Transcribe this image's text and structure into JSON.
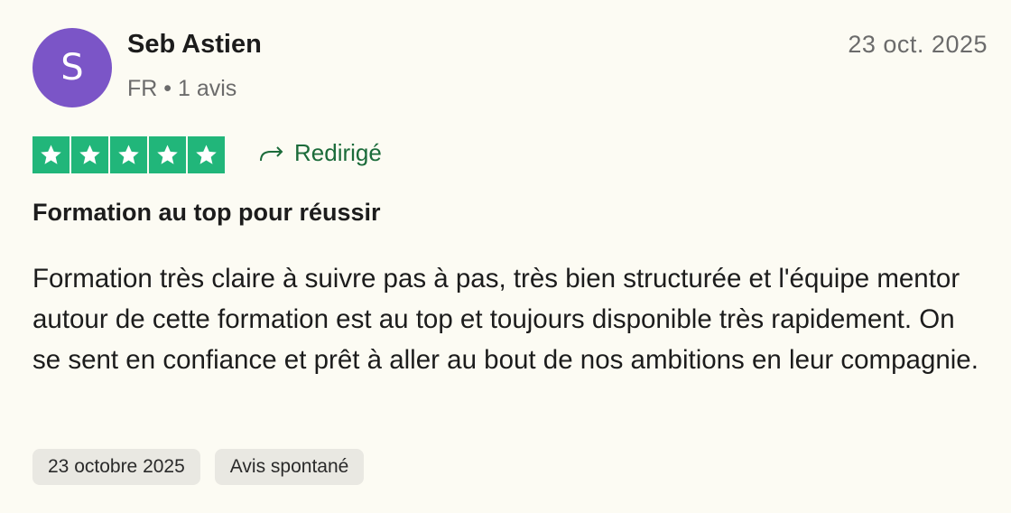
{
  "reviewer": {
    "avatar_initial": "S",
    "avatar_color": "#7b55c7",
    "name": "Seb Astien",
    "meta": "FR • 1 avis"
  },
  "review": {
    "date_short": "23 oct. 2025",
    "rating": 5,
    "rating_color": "#21b67a",
    "redirected_label": "Redirigé",
    "title": "Formation au top pour réussir",
    "body": "Formation très claire à suivre pas à pas, très bien structurée et l'équipe mentor autour de cette formation est au top et toujours disponible très rapidement. On se sent en confiance et prêt à aller au bout de nos ambitions en leur compagnie.",
    "tags": [
      "23 octobre 2025",
      "Avis spontané"
    ]
  }
}
